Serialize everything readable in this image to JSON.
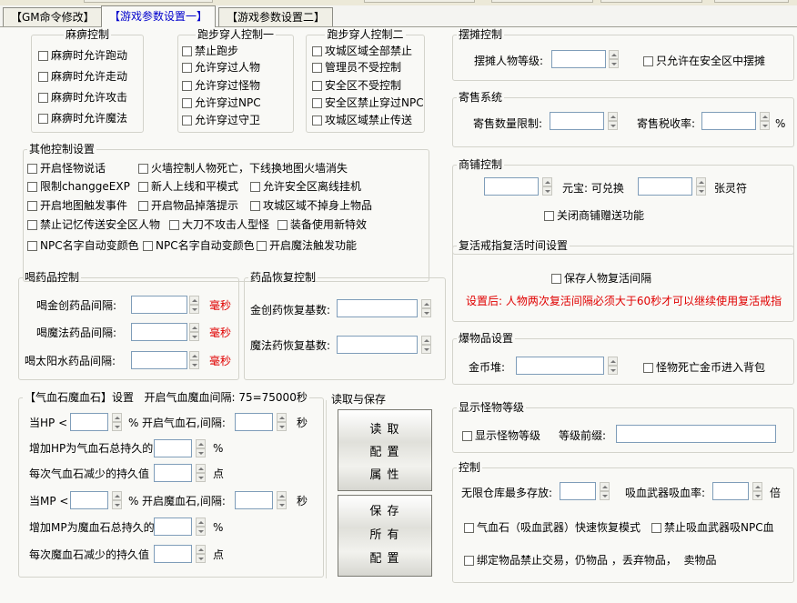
{
  "tabs": [
    {
      "label": "【GM命令修改】"
    },
    {
      "label": "【游戏参数设置一】"
    },
    {
      "label": "【游戏参数设置二】"
    }
  ],
  "paralysis": {
    "title": "麻痹控制",
    "items": [
      "麻痹时允许跑动",
      "麻痹时允许走动",
      "麻痹时允许攻击",
      "麻痹时允许魔法"
    ]
  },
  "pass1": {
    "title": "跑步穿人控制一",
    "items": [
      "禁止跑步",
      "允许穿过人物",
      "允许穿过怪物",
      "允许穿过NPC",
      "允许穿过守卫"
    ]
  },
  "pass2": {
    "title": "跑步穿人控制二",
    "items": [
      "攻城区域全部禁止",
      "管理员不受控制",
      "安全区不受控制",
      "安全区禁止穿过NPC",
      "攻城区域禁止传送"
    ]
  },
  "other": {
    "title": "其他控制设置",
    "rows": [
      [
        "开启怪物说话",
        "火墙控制人物死亡，下线换地图火墙消失"
      ],
      [
        "限制changgeEXP",
        "新人上线和平模式",
        "允许安全区离线挂机"
      ],
      [
        "开启地图触发事件",
        "开启物品掉落提示",
        "攻城区域不掉身上物品"
      ],
      [
        "禁止记忆传送安全区人物",
        "大刀不攻击人型怪",
        "装备使用新特效"
      ],
      [
        "NPC名字自动变颜色",
        "NPC名字自动变颜色",
        "开启魔法触发功能"
      ]
    ]
  },
  "drink": {
    "title": "喝药品控制",
    "rows": [
      {
        "label": "喝金创药品间隔:",
        "unit": "毫秒"
      },
      {
        "label": "喝魔法药品间隔:",
        "unit": "毫秒"
      },
      {
        "label": "喝太阳水药品间隔:",
        "unit": "毫秒"
      }
    ]
  },
  "recover": {
    "title": "药品恢复控制",
    "rows": [
      "金创药恢复基数:",
      "魔法药恢复基数:"
    ]
  },
  "stone": {
    "title": "【气血石魔血石】设置",
    "hint": "开启气血魔血间隔: 75=75000秒",
    "hp_lt": "当HP <",
    "pct": "%",
    "open_hp": "开启气血石,间隔:",
    "sec": "秒",
    "add_hp": "增加HP为气血石总持久的",
    "dec_hp": "每次气血石减少的持久值",
    "point": "点",
    "mp_lt": "当MP <",
    "open_mp": "开启魔血石,间隔:",
    "add_mp": "增加MP为魔血石总持久的",
    "dec_mp": "每次魔血石减少的持久值"
  },
  "io": {
    "title": "读取与保存",
    "load": [
      "读 取",
      "配 置",
      "属 性"
    ],
    "save": [
      "保 存",
      "所 有",
      "配 置"
    ]
  },
  "stall": {
    "title": "摆摊控制",
    "level": "摆摊人物等级:",
    "safe_only": "只允许在安全区中摆摊"
  },
  "consign": {
    "title": "寄售系统",
    "limit": "寄售数量限制:",
    "tax": "寄售税收率:",
    "pct": "%"
  },
  "shop": {
    "title": "商铺控制",
    "yuanbao": "元宝: 可兑换",
    "card": "张灵符",
    "close_gift": "关闭商铺赠送功能"
  },
  "revive": {
    "title": "复活戒指复活时间设置",
    "save": "保存人物复活间隔",
    "note": "设置后: 人物两次复活间隔必须大于60秒才可以继续使用复活戒指"
  },
  "drop": {
    "title": "爆物品设置",
    "gold": "金币堆:",
    "to_bag": "怪物死亡金币进入背包"
  },
  "mlevel": {
    "title": "显示怪物等级",
    "show": "显示怪物等级",
    "prefix": "等级前缀:"
  },
  "ctrl": {
    "title": "控制",
    "storage": "无限仓库最多存放:",
    "vamp": "吸血武器吸血率:",
    "bei": "倍",
    "fast": "气血石（吸血武器）快速恢复模式",
    "no_npc": "禁止吸血武器吸NPC血",
    "bind": "绑定物品禁止交易，仍物品 ，丢弃物品，  卖物品"
  }
}
